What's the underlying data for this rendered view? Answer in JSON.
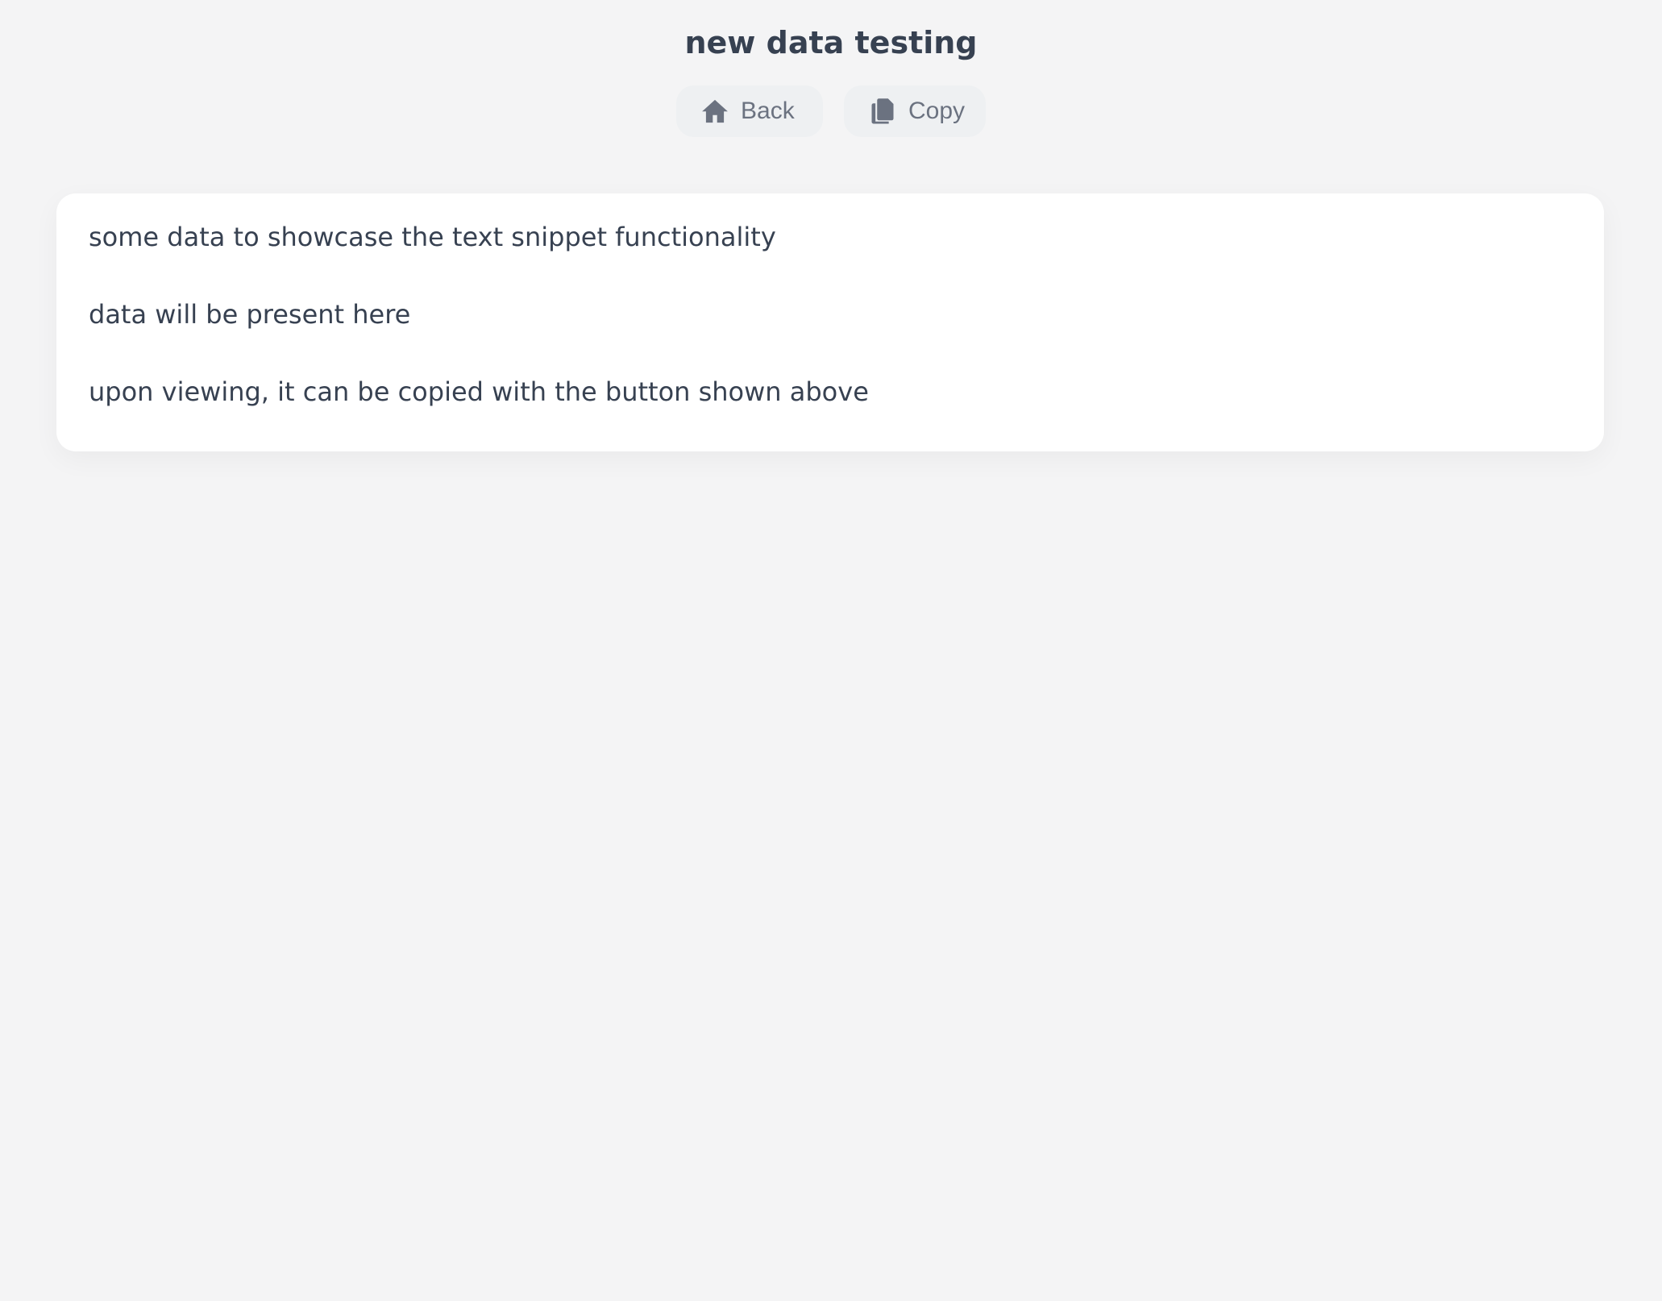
{
  "header": {
    "title": "new data testing"
  },
  "toolbar": {
    "back": {
      "label": "Back",
      "icon": "home-icon"
    },
    "copy": {
      "label": "Copy",
      "icon": "copy-icon"
    }
  },
  "snippet": {
    "lines": [
      "some data to showcase the text snippet functionality",
      "data will be present here",
      "upon viewing, it can be copied with the button shown above"
    ]
  },
  "colors": {
    "background": "#f4f4f5",
    "card": "#ffffff",
    "button_bg": "#eef0f2",
    "button_text": "#6b7280",
    "text": "#374151"
  }
}
